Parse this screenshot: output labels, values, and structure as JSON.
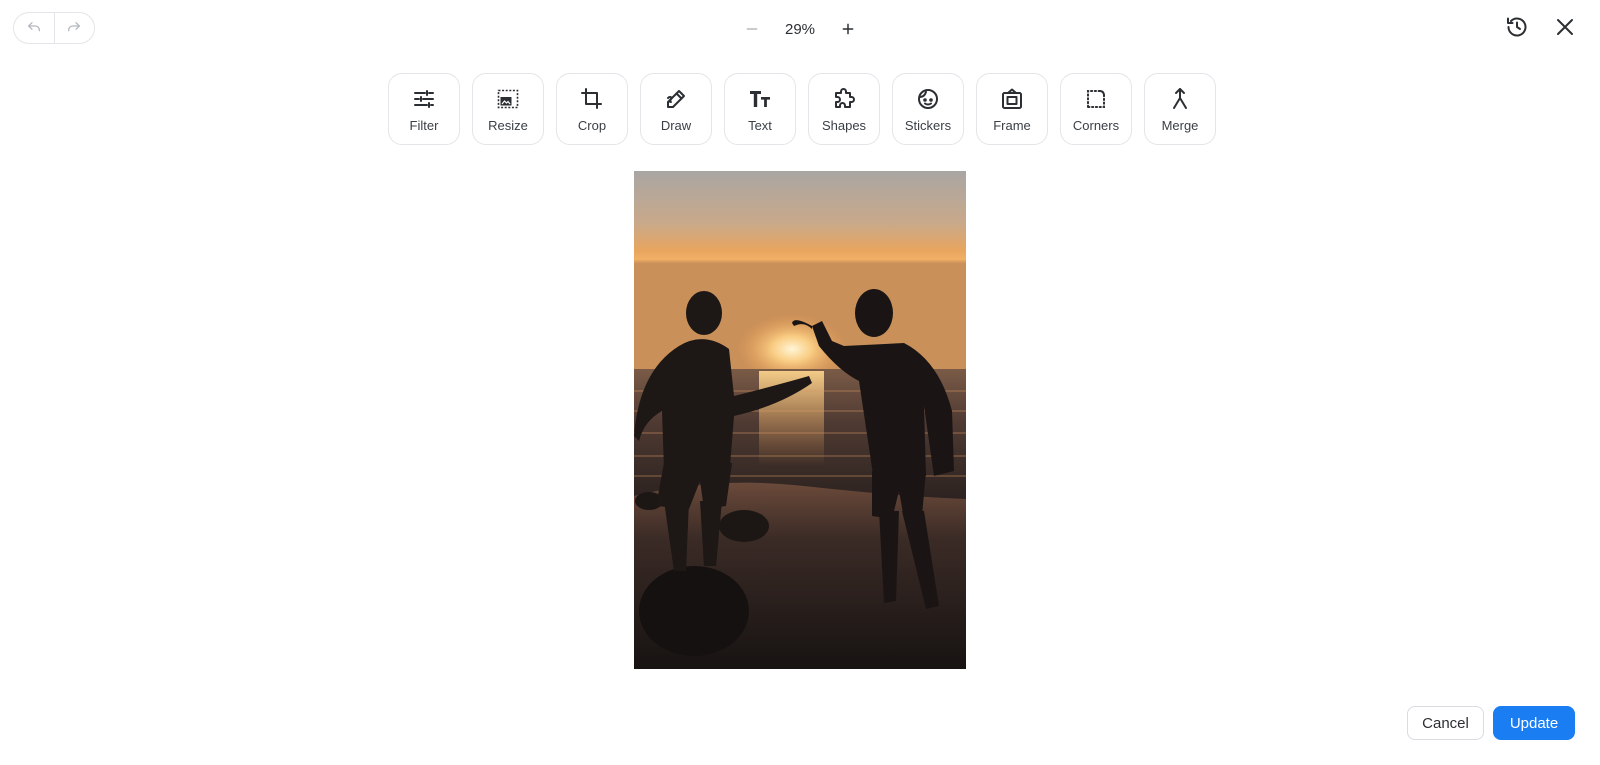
{
  "history": {
    "undo_icon": "undo-icon",
    "redo_icon": "redo-icon"
  },
  "zoom": {
    "value": "29%",
    "minus_icon": "minus-icon",
    "plus_icon": "plus-icon"
  },
  "top_right": {
    "history_icon": "history-clock-icon",
    "close_icon": "close-icon"
  },
  "toolbar": {
    "tools": [
      {
        "label": "Filter",
        "icon": "sliders-icon"
      },
      {
        "label": "Resize",
        "icon": "resize-icon"
      },
      {
        "label": "Crop",
        "icon": "crop-icon"
      },
      {
        "label": "Draw",
        "icon": "pencil-icon"
      },
      {
        "label": "Text",
        "icon": "text-icon"
      },
      {
        "label": "Shapes",
        "icon": "shapes-icon"
      },
      {
        "label": "Stickers",
        "icon": "sticker-icon"
      },
      {
        "label": "Frame",
        "icon": "frame-icon"
      },
      {
        "label": "Corners",
        "icon": "corners-icon"
      },
      {
        "label": "Merge",
        "icon": "merge-icon"
      }
    ]
  },
  "footer": {
    "cancel_label": "Cancel",
    "update_label": "Update"
  },
  "colors": {
    "accent": "#1a7ef2",
    "border": "#e3e5e8",
    "icon": "#2b2f33"
  }
}
